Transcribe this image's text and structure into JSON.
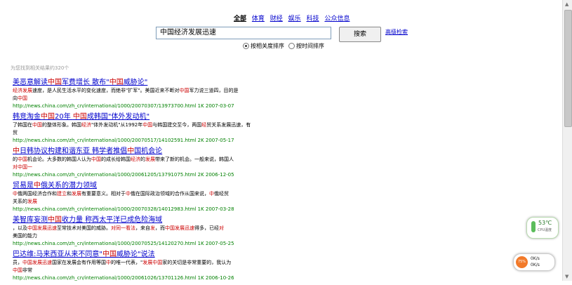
{
  "nav": {
    "all": "全部",
    "sports": "体育",
    "finance": "财经",
    "entertainment": "娱乐",
    "tech": "科技",
    "public": "公众信息"
  },
  "search": {
    "value": "中国经济发展迅速",
    "button": "搜索",
    "advanced": "高级检索"
  },
  "sort": {
    "relevance": "按相关度排序",
    "time": "按时间排序"
  },
  "result_count": "为您找到相关结果约320个",
  "results": [
    {
      "title": [
        "美恶意解读",
        "中国",
        "军费增长 散布\"",
        "中国",
        "威胁论\""
      ],
      "snippet": [
        [
          "经济",
          "发展",
          "速度，是人民生活水平的变化速度，而绝非\"扩军\"。美国近来不断对",
          "中国",
          "军力说三道四，目的是\n向",
          "中国"
        ]
      ],
      "url": "http://news.china.com/zh_cn/international/1000/20070307/13973700.html 1K 2007-03-07"
    },
    {
      "title": [
        "韩竞淘金",
        "中国",
        "20年 ",
        "中国",
        "成韩国\"体外发动机\""
      ],
      "snippet": [
        [
          "了韩国在",
          "中国",
          "的整体形象。韩国",
          "经济",
          "\"体外发动机\"从1992年",
          "中国",
          "与韩国建交至今，两国",
          "经",
          "贸关系",
          "发展迅速",
          "，有\n贸"
        ]
      ],
      "url": "http://news.china.com/zh_cn/international/1000/20070517/14102591.html 2K 2007-05-17"
    },
    {
      "title": [
        "中",
        "日韩协议构建和谐东亚 韩学者推倡",
        "中",
        "国机会论"
      ],
      "snippet": [
        [
          "的",
          "中国",
          "机会论。大多数的韩国人认为",
          "中国",
          "的成长给韩国",
          "经济",
          "的",
          "发展",
          "带来了新的机会。一般来说，韩国人\n对",
          "中国",
          "一"
        ]
      ],
      "url": "http://news.china.com/zh_cn/international/1000/20061205/13791075.html 2K 2006-12-05"
    },
    {
      "title": [
        "贸易是",
        "中",
        "俄关系的潜力领域"
      ],
      "snippet": [
        [
          "中",
          "俄两国经济合作和",
          "建立",
          "和",
          "发展",
          "有重要意义。相对于",
          "中",
          "俄在国际政治领域的合作从国来说，",
          "中",
          "俄经贸\n关系的",
          "发展"
        ]
      ],
      "url": "http://news.china.com/zh_cn/international/1000/20070328/14012983.html 1K 2007-03-28"
    },
    {
      "title": [
        "美智库妄测",
        "中国",
        "收力量 称西太平洋已成危险海域"
      ],
      "snippet": [
        [
          "，以及",
          "中国",
          "发展",
          "迅速",
          "至常技术对美国的威胁。",
          "对",
          "同",
          "一",
          "看",
          "法",
          "，来自",
          "发",
          "，而",
          "中国",
          "发展",
          "迅速",
          "得多，已经",
          "对\n美国的能力"
        ]
      ],
      "url": "http://news.china.com/zh_cn/international/1000/20070525/14120270.html 1K 2007-05-25"
    },
    {
      "title": [
        "巴达维:马来西亚从来不同意\"",
        "中国",
        "威胁论\"说法"
      ],
      "snippet": [
        [
          "员，",
          "中国",
          "发展",
          "迅速",
          "国家在发展会有作用等国",
          "中",
          "的唯一代表，\"",
          "发展",
          "中国",
          "家的关切是非常重要的，我认为\n",
          "中国",
          "非常"
        ]
      ],
      "url": "http://news.china.com/zh_cn/international/1000/20061026/13701126.html 1K 2006-10-26"
    }
  ],
  "widgets": {
    "temperature": "53℃",
    "temp_label": "CPU温度",
    "gauge": "75%",
    "upload": "0K/s",
    "download": "0K/s"
  }
}
